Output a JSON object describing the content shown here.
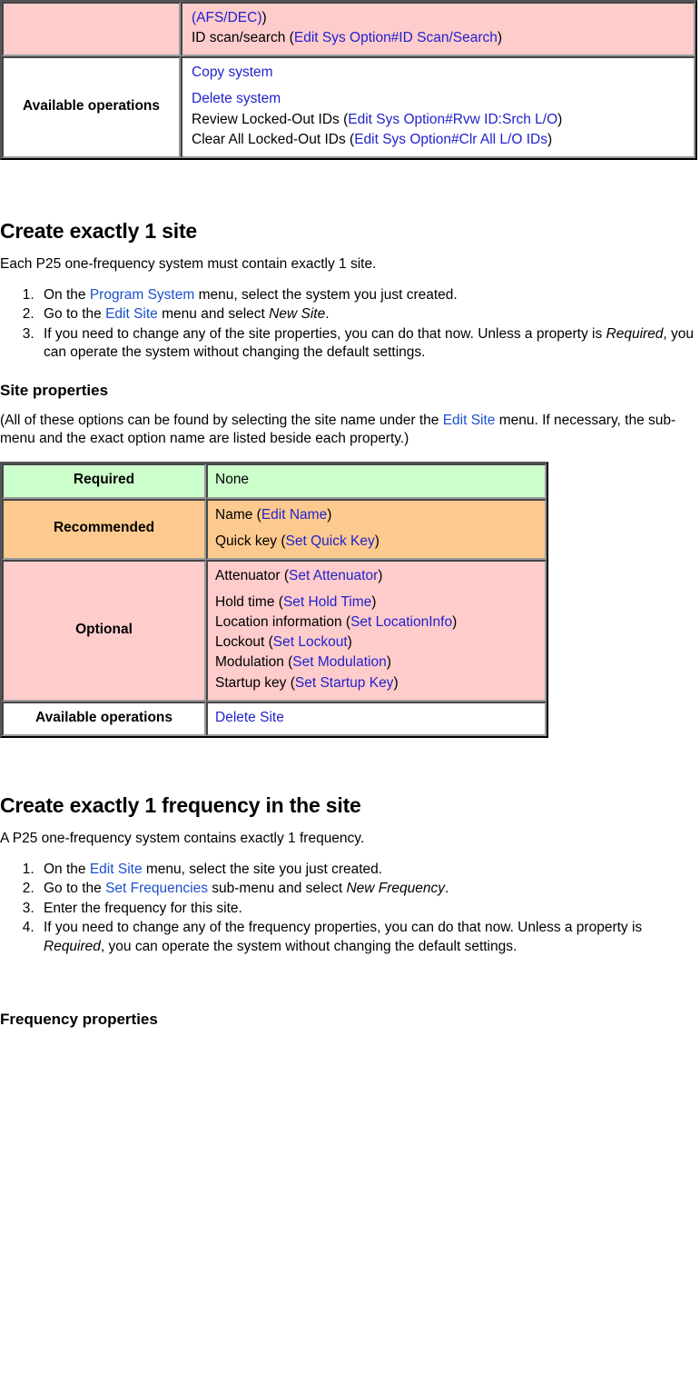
{
  "system_table": {
    "name": "system-properties-table-continued",
    "rows": [
      {
        "label": "",
        "style": "pink",
        "lines": [
          {
            "segments": [
              {
                "t": "(AFS/DEC)",
                "link": true
              },
              {
                "t": ")",
                "link": false
              }
            ]
          },
          {
            "segments": [
              {
                "t": "ID scan/search (",
                "link": false
              },
              {
                "t": "Edit Sys Option#ID Scan/Search",
                "link": true
              },
              {
                "t": ")",
                "link": false
              }
            ]
          }
        ]
      },
      {
        "label": "Available operations",
        "style": "white",
        "lines": [
          {
            "spaced": false,
            "segments": [
              {
                "t": "Copy system",
                "link": true
              }
            ]
          },
          {
            "spaced": true,
            "segments": [
              {
                "t": "Delete system",
                "link": true
              }
            ]
          },
          {
            "segments": [
              {
                "t": "Review Locked-Out IDs (",
                "link": false
              },
              {
                "t": "Edit Sys Option#Rvw ID:Srch L/O",
                "link": true
              },
              {
                "t": ")",
                "link": false
              }
            ]
          },
          {
            "segments": [
              {
                "t": "Clear All Locked-Out IDs (",
                "link": false
              },
              {
                "t": "Edit Sys Option#Clr All L/O IDs",
                "link": true
              },
              {
                "t": ")",
                "link": false
              }
            ]
          }
        ]
      }
    ]
  },
  "site_section": {
    "heading": "Create exactly 1 site",
    "intro": "Each P25 one-frequency system must contain exactly 1 site.",
    "steps": [
      {
        "parts": [
          {
            "t": "On the ",
            "k": "plain"
          },
          {
            "t": "Program System",
            "k": "link"
          },
          {
            "t": " menu, select the system you just created.",
            "k": "plain"
          }
        ]
      },
      {
        "parts": [
          {
            "t": "Go to the ",
            "k": "plain"
          },
          {
            "t": "Edit Site",
            "k": "link"
          },
          {
            "t": " menu and select ",
            "k": "plain"
          },
          {
            "t": "New Site",
            "k": "em"
          },
          {
            "t": ".",
            "k": "plain"
          }
        ]
      },
      {
        "parts": [
          {
            "t": "If you need to change any of the site properties, you can do that now. Unless a property is ",
            "k": "plain"
          },
          {
            "t": "Required",
            "k": "em"
          },
          {
            "t": ", you can operate the system without changing the default settings.",
            "k": "plain"
          }
        ]
      }
    ]
  },
  "site_properties": {
    "heading": "Site properties",
    "note": [
      {
        "t": "(All of these options can be found by selecting the site name under the ",
        "k": "plain"
      },
      {
        "t": "Edit Site",
        "k": "link"
      },
      {
        "t": " menu. If necessary, the sub-menu and the exact option name are listed beside each property.)",
        "k": "plain"
      }
    ],
    "table": {
      "name": "site-properties-table",
      "rows": [
        {
          "label": "Required",
          "style": "green",
          "lines": [
            {
              "segments": [
                {
                  "t": "None",
                  "link": false
                }
              ]
            }
          ]
        },
        {
          "label": "Recommended",
          "style": "orange",
          "lines": [
            {
              "segments": [
                {
                  "t": "Name (",
                  "link": false
                },
                {
                  "t": "Edit Name",
                  "link": true
                },
                {
                  "t": ")",
                  "link": false
                }
              ]
            },
            {
              "spaced": true,
              "segments": [
                {
                  "t": "Quick key (",
                  "link": false
                },
                {
                  "t": "Set Quick Key",
                  "link": true
                },
                {
                  "t": ")",
                  "link": false
                }
              ]
            }
          ]
        },
        {
          "label": "Optional",
          "style": "pink",
          "lines": [
            {
              "segments": [
                {
                  "t": "Attenuator (",
                  "link": false
                },
                {
                  "t": "Set Attenuator",
                  "link": true
                },
                {
                  "t": ")",
                  "link": false
                }
              ]
            },
            {
              "spaced": true,
              "segments": [
                {
                  "t": "Hold time (",
                  "link": false
                },
                {
                  "t": "Set Hold Time",
                  "link": true
                },
                {
                  "t": ")",
                  "link": false
                }
              ]
            },
            {
              "segments": [
                {
                  "t": "Location information (",
                  "link": false
                },
                {
                  "t": "Set LocationInfo",
                  "link": true
                },
                {
                  "t": ")",
                  "link": false
                }
              ]
            },
            {
              "segments": [
                {
                  "t": "Lockout (",
                  "link": false
                },
                {
                  "t": "Set Lockout",
                  "link": true
                },
                {
                  "t": ")",
                  "link": false
                }
              ]
            },
            {
              "segments": [
                {
                  "t": "Modulation (",
                  "link": false
                },
                {
                  "t": "Set Modulation",
                  "link": true
                },
                {
                  "t": ")",
                  "link": false
                }
              ]
            },
            {
              "segments": [
                {
                  "t": "Startup key (",
                  "link": false
                },
                {
                  "t": "Set Startup Key",
                  "link": true
                },
                {
                  "t": ")",
                  "link": false
                }
              ]
            }
          ]
        },
        {
          "label": "Available operations",
          "style": "white",
          "lines": [
            {
              "segments": [
                {
                  "t": "Delete Site",
                  "link": true
                }
              ]
            }
          ]
        }
      ]
    }
  },
  "frequency_section": {
    "heading": "Create exactly 1 frequency in the site",
    "intro": "A P25 one-frequency system contains exactly 1 frequency.",
    "steps": [
      {
        "parts": [
          {
            "t": "On the ",
            "k": "plain"
          },
          {
            "t": "Edit Site",
            "k": "link"
          },
          {
            "t": " menu, select the site you just created.",
            "k": "plain"
          }
        ]
      },
      {
        "parts": [
          {
            "t": "Go to the ",
            "k": "plain"
          },
          {
            "t": "Set Frequencies",
            "k": "link"
          },
          {
            "t": " sub-menu and select ",
            "k": "plain"
          },
          {
            "t": "New Frequency",
            "k": "em"
          },
          {
            "t": ".",
            "k": "plain"
          }
        ]
      },
      {
        "parts": [
          {
            "t": "Enter the frequency for this site.",
            "k": "plain"
          }
        ]
      },
      {
        "parts": [
          {
            "t": "If you need to change any of the frequency properties, you can do that now. Unless a property is ",
            "k": "plain"
          },
          {
            "t": "Required",
            "k": "em"
          },
          {
            "t": ", you can operate the system without changing the default settings.",
            "k": "plain"
          }
        ]
      }
    ]
  },
  "frequency_properties": {
    "heading": "Frequency properties"
  },
  "colors": {
    "required_row": "#ccffcc",
    "recommended_row": "#fcca8e",
    "optional_row": "#ffcccc",
    "operations_row": "#ffffff",
    "link": "#2222cc",
    "body_link": "#1a4fd0",
    "text": "#000000",
    "table_border": "#9a9a9a"
  }
}
